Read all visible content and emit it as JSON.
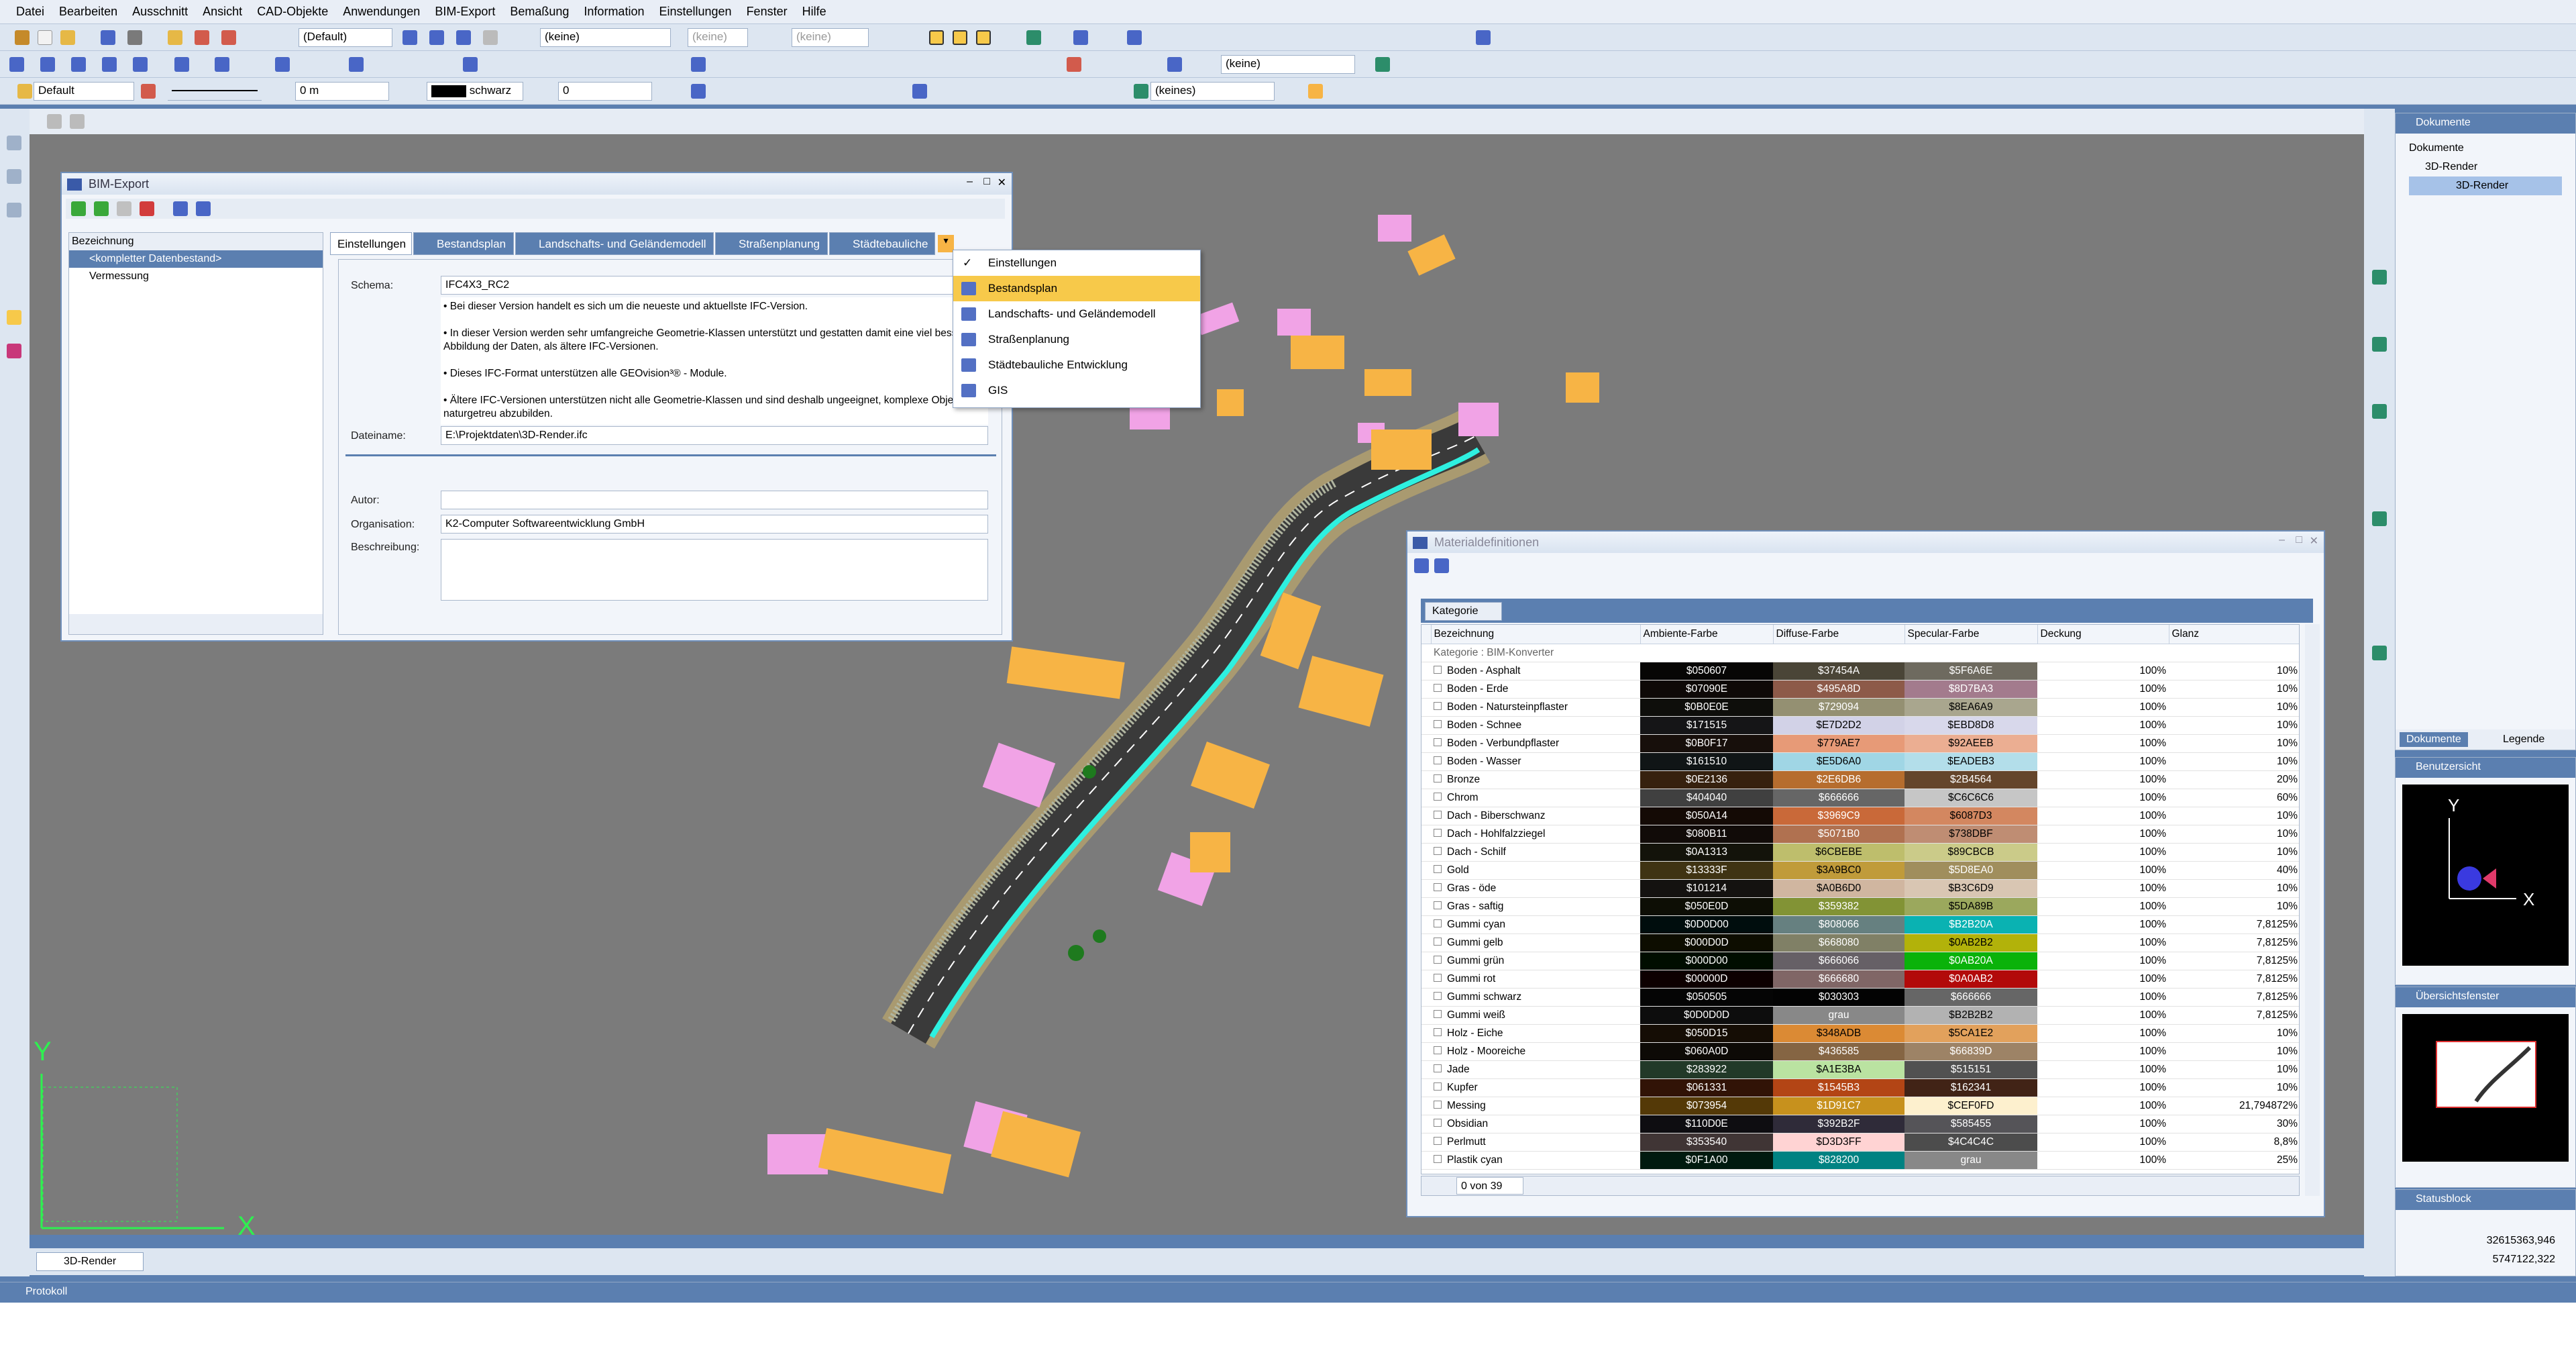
{
  "menu": [
    "Datei",
    "Bearbeiten",
    "Ausschnitt",
    "Ansicht",
    "CAD-Objekte",
    "Anwendungen",
    "BIM-Export",
    "Bemaßung",
    "Information",
    "Einstellungen",
    "Fenster",
    "Hilfe"
  ],
  "toolbar": {
    "style": "(Default)",
    "layer1": "(keine)",
    "layer2": "(keine)",
    "layer3": "(keine)",
    "layer_right": "(keine)",
    "pen": "Default",
    "dist": "0 m",
    "color": "schwarz",
    "value": "0",
    "group": "(keines)"
  },
  "bim_export": {
    "title": "BIM-Export",
    "tree_header": "Bezeichnung",
    "tree_items": [
      "<kompletter Datenbestand>",
      "Vermessung"
    ],
    "tabs": [
      "Einstellungen",
      "Bestandsplan",
      "Landschafts- und Geländemodell",
      "Straßenplanung",
      "Städtebauliche"
    ],
    "schema_label": "Schema:",
    "schema_value": "IFC4X3_RC2",
    "desc": [
      "• Bei dieser Version handelt es sich um die neueste und aktuellste IFC-Version.",
      "• In dieser Version werden sehr umfangreiche Geometrie-Klassen unterstützt und gestatten damit eine viel bessere Abbildung der Daten, als ältere IFC-Versionen.",
      "• Dieses IFC-Format unterstützen alle GEOvision³® - Module.",
      "• Ältere IFC-Versionen unterstützen nicht alle Geometrie-Klassen und sind deshalb ungeeignet, komplexe Objekte naturgetreu abzubilden."
    ],
    "file_label": "Dateiname:",
    "file_value": "E:\\Projektdaten\\3D-Render.ifc",
    "author_label": "Autor:",
    "author_value": "",
    "org_label": "Organisation:",
    "org_value": "K2-Computer Softwareentwicklung GmbH",
    "descr_label": "Beschreibung:",
    "descr_value": ""
  },
  "dropdown": [
    "Einstellungen",
    "Bestandsplan",
    "Landschafts- und Geländemodell",
    "Straßenplanung",
    "Städtebauliche Entwicklung",
    "GIS"
  ],
  "materials": {
    "title": "Materialdefinitionen",
    "group_label": "Kategorie",
    "columns": [
      "Bezeichnung",
      "Ambiente-Farbe",
      "Diffuse-Farbe",
      "Specular-Farbe",
      "Deckung",
      "Glanz"
    ],
    "group_row": "Kategorie : BIM-Konverter",
    "rows": [
      [
        "Boden - Asphalt",
        "$050607",
        "$37454A",
        "$5F6A6E",
        "100%",
        "10%"
      ],
      [
        "Boden - Erde",
        "$07090E",
        "$495A8D",
        "$8D7BA3",
        "100%",
        "10%"
      ],
      [
        "Boden - Natursteinpflaster",
        "$0B0E0E",
        "$729094",
        "$8EA6A9",
        "100%",
        "10%"
      ],
      [
        "Boden - Schnee",
        "$171515",
        "$E7D2D2",
        "$EBD8D8",
        "100%",
        "10%"
      ],
      [
        "Boden - Verbundpflaster",
        "$0B0F17",
        "$779AE7",
        "$92AEEB",
        "100%",
        "10%"
      ],
      [
        "Boden - Wasser",
        "$161510",
        "$E5D6A0",
        "$EADEB3",
        "100%",
        "10%"
      ],
      [
        "Bronze",
        "$0E2136",
        "$2E6DB6",
        "$2B4564",
        "100%",
        "20%"
      ],
      [
        "Chrom",
        "$404040",
        "$666666",
        "$C6C6C6",
        "100%",
        "60%"
      ],
      [
        "Dach - Biberschwanz",
        "$050A14",
        "$3969C9",
        "$6087D3",
        "100%",
        "10%"
      ],
      [
        "Dach - Hohlfalzziegel",
        "$080B11",
        "$5071B0",
        "$738DBF",
        "100%",
        "10%"
      ],
      [
        "Dach - Schilf",
        "$0A1313",
        "$6CBEBE",
        "$89CBCB",
        "100%",
        "10%"
      ],
      [
        "Gold",
        "$13333F",
        "$3A9BC0",
        "$5D8EA0",
        "100%",
        "40%"
      ],
      [
        "Gras - öde",
        "$101214",
        "$A0B6D0",
        "$B3C6D9",
        "100%",
        "10%"
      ],
      [
        "Gras - saftig",
        "$050E0D",
        "$359382",
        "$5DA89B",
        "100%",
        "10%"
      ],
      [
        "Gummi cyan",
        "$0D0D00",
        "$808066",
        "$B2B20A",
        "100%",
        "7,8125%"
      ],
      [
        "Gummi gelb",
        "$000D0D",
        "$668080",
        "$0AB2B2",
        "100%",
        "7,8125%"
      ],
      [
        "Gummi grün",
        "$000D00",
        "$666066",
        "$0AB20A",
        "100%",
        "7,8125%"
      ],
      [
        "Gummi rot",
        "$00000D",
        "$666680",
        "$0A0AB2",
        "100%",
        "7,8125%"
      ],
      [
        "Gummi schwarz",
        "$050505",
        "$030303",
        "$666666",
        "100%",
        "7,8125%"
      ],
      [
        "Gummi weiß",
        "$0D0D0D",
        "grau",
        "$B2B2B2",
        "100%",
        "7,8125%"
      ],
      [
        "Holz - Eiche",
        "$050D15",
        "$348ADB",
        "$5CA1E2",
        "100%",
        "10%"
      ],
      [
        "Holz - Mooreiche",
        "$060A0D",
        "$436585",
        "$66839D",
        "100%",
        "10%"
      ],
      [
        "Jade",
        "$283922",
        "$A1E3BA",
        "$515151",
        "100%",
        "10%"
      ],
      [
        "Kupfer",
        "$061331",
        "$1545B3",
        "$162341",
        "100%",
        "10%"
      ],
      [
        "Messing",
        "$073954",
        "$1D91C7",
        "$CEF0FD",
        "100%",
        "21,794872%"
      ],
      [
        "Obsidian",
        "$110D0E",
        "$392B2F",
        "$585455",
        "100%",
        "30%"
      ],
      [
        "Perlmutt",
        "$353540",
        "$D3D3FF",
        "$4C4C4C",
        "100%",
        "8,8%"
      ],
      [
        "Plastik cyan",
        "$0F1A00",
        "$828200",
        "grau",
        "100%",
        "25%"
      ]
    ],
    "pager": "0 von 39"
  },
  "colors": {
    "accent": "#5b7fb0",
    "canvas": "#7b7b7b",
    "building_orange": "#f7b445",
    "building_pink": "#f1a3e6",
    "road_cyan": "#2ef0e0",
    "selection": "#f7c94a"
  },
  "right_panels": {
    "docs_title": "Dokumente",
    "tree_root": "Dokumente",
    "tree_child": "3D-Render",
    "tree_leaf": "3D-Render",
    "tab_docs": "Dokumente",
    "tab_legend": "Legende",
    "user_view": "Benutzersicht",
    "overview": "Übersichtsfenster",
    "status": "Statusblock",
    "coord_x": "32615363,946",
    "coord_y": "5747122,322",
    "axis_x": "X",
    "axis_y": "Y"
  },
  "doc_tab": "3D-Render",
  "log_title": "Protokoll",
  "canvas_axes": {
    "x": "X",
    "y": "Y"
  }
}
